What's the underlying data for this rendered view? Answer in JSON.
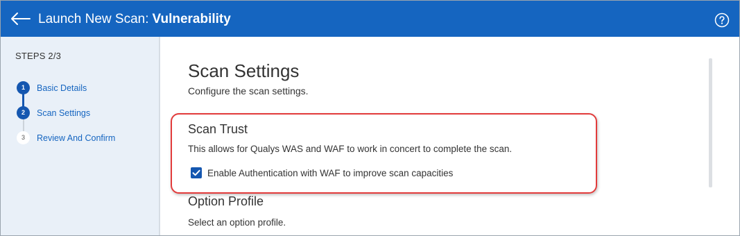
{
  "header": {
    "title": "Launch New Scan:",
    "scan_type": "Vulnerability",
    "back_icon": "arrow-left-icon",
    "help_icon": "question-circle-icon"
  },
  "sidebar": {
    "steps_heading": "STEPS 2/3",
    "steps": [
      {
        "number": "1",
        "label": "Basic Details",
        "state": "completed"
      },
      {
        "number": "2",
        "label": "Scan Settings",
        "state": "current"
      },
      {
        "number": "3",
        "label": "Review And Confirm",
        "state": "pending"
      }
    ]
  },
  "main": {
    "title": "Scan Settings",
    "subtitle": "Configure the scan settings.",
    "scan_trust": {
      "title": "Scan Trust",
      "description": "This allows for Qualys WAS and WAF to work in concert to complete the scan.",
      "checkbox_label": "Enable Authentication with WAF to improve scan capacities",
      "checked": true
    },
    "option_profile": {
      "title": "Option Profile",
      "description": "Select an option profile."
    }
  },
  "colors": {
    "header_bg": "#1565c0",
    "accent": "#1557b0",
    "sidebar_bg": "#e9f0f8",
    "highlight_border": "#e23b3b"
  }
}
